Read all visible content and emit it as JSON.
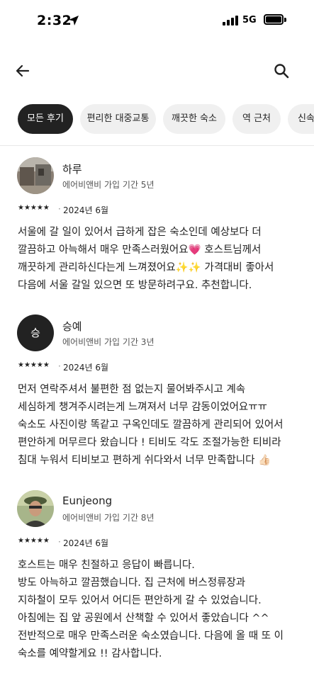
{
  "status_bar": {
    "time": "2:32",
    "network": "5G"
  },
  "nav": {
    "back_icon": "arrow-left-icon",
    "search_icon": "search-icon"
  },
  "filters": [
    {
      "label": "모든 후기",
      "active": true
    },
    {
      "label": "편리한 대중교통",
      "active": false
    },
    {
      "label": "깨끗한 숙소",
      "active": false
    },
    {
      "label": "역 근처",
      "active": false
    },
    {
      "label": "신속",
      "active": false
    }
  ],
  "reviews": [
    {
      "name": "하루",
      "meta": "에어비앤비 가입 기간 5년",
      "stars": "★★★★★",
      "rating": 5,
      "separator": "·",
      "date": "2024년 6월",
      "lines": [
        "서울에 갈 일이 있어서 급하게 잡은 숙소인데 예상보다 더",
        "깔끔하고 아늑해서 매우 만족스러웠어요💗 호스트님께서",
        "깨끗하게 관리하신다는게 느껴졌어요✨✨  가격대비 좋아서",
        "다음에 서울 갈일 있으면 또 방문하려구요. 추천합니다."
      ]
    },
    {
      "name": "승예",
      "avatar_letter": "승",
      "meta": "에어비앤비 가입 기간 3년",
      "stars": "★★★★★",
      "rating": 5,
      "separator": "·",
      "date": "2024년 6월",
      "lines": [
        "먼저 연락주셔서 불편한 점 없는지 물어봐주시고 계속",
        "세심하게 챙겨주시려는게 느껴져서 너무 감동이었어요ㅠㅠ",
        "숙소도 사진이랑 똑같고 구옥인데도 깔끔하게 관리되어 있어서",
        "편안하게 머무르다 왔습니다 ! 티비도 각도 조절가능한 티비라",
        "침대 누워서 티비보고 편하게 쉬다와서 너무 만족합니다 👍🏻"
      ]
    },
    {
      "name": "Eunjeong",
      "meta": "에어비앤비 가입 기간 8년",
      "stars": "★★★★★",
      "rating": 5,
      "separator": "·",
      "date": "2024년 6월",
      "lines": [
        "호스트는 매우 친절하고 응답이 빠릅니다.",
        "방도 아늑하고 깔끔했습니다. 집 근처에 버스정류장과",
        "지하철이 모두 있어서 어디든 편안하게 갈 수 있었습니다.",
        "아침에는 집 앞 공원에서 산책할 수 있어서 좋았습니다 ^^",
        "전반적으로 매우 만족스러운 숙소였습니다. 다음에 올 때 또 이",
        "숙소를 예약할게요 !! 감사합니다."
      ]
    }
  ]
}
